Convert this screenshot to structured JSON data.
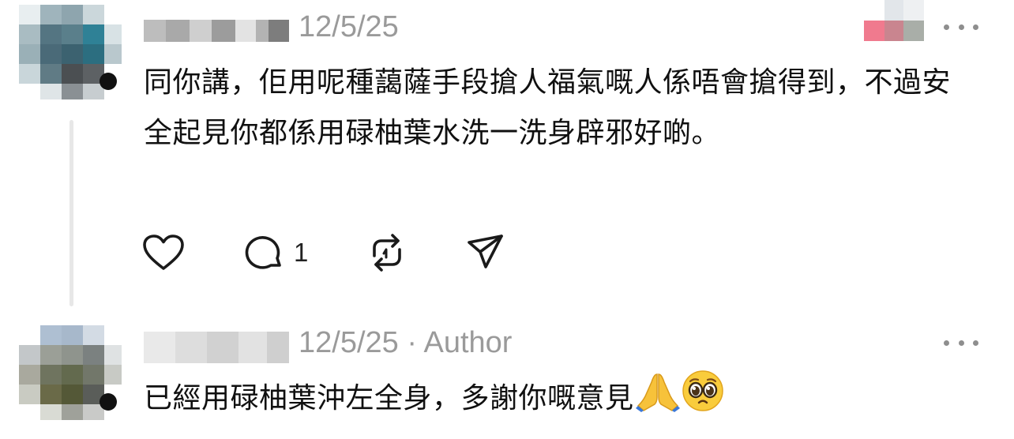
{
  "comments": [
    {
      "date": "12/5/25",
      "author_tag": "",
      "text": "同你講，佢用呢種藹薩手段搶人福氣嘅人係唔會搶得到，不過安全起見你都係用碌柚葉水洗一洗身辟邪好啲。",
      "actions": {
        "reply_count": "1"
      }
    },
    {
      "date": "12/5/25",
      "author_tag": "· Author",
      "text": "已經用碌柚葉沖左全身，多謝你嘅意見"
    }
  ],
  "icons": {
    "like": "heart-icon",
    "reply": "speech-bubble-icon",
    "repost": "repost-icon",
    "share": "paper-plane-icon",
    "more": "ellipsis-icon",
    "emoji_1": "folded-hands-emoji",
    "emoji_2": "pleading-face-emoji"
  },
  "colors": {
    "meta_text": "#9a9a9a",
    "body_text": "#101010",
    "thread_line": "#e7e7e7"
  }
}
